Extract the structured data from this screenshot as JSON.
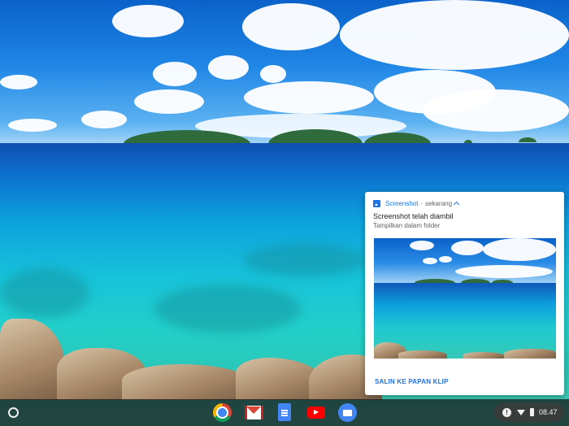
{
  "notification": {
    "app_name": "Screenshot",
    "separator": "·",
    "timestamp": "sekarang",
    "title": "Screenshot telah diambil",
    "message": "Tampilkan dalam folder",
    "action_label": "SALIN KE PAPAN KLIP"
  },
  "shelf": {
    "apps": [
      {
        "name": "chrome-icon"
      },
      {
        "name": "gmail-icon"
      },
      {
        "name": "docs-icon"
      },
      {
        "name": "youtube-icon"
      },
      {
        "name": "files-icon"
      }
    ]
  },
  "status_tray": {
    "icons": [
      "info-icon",
      "wifi-icon",
      "battery-icon"
    ],
    "time": "08.47"
  },
  "colors": {
    "accent": "#1a73e8",
    "shelf": "#141414"
  }
}
